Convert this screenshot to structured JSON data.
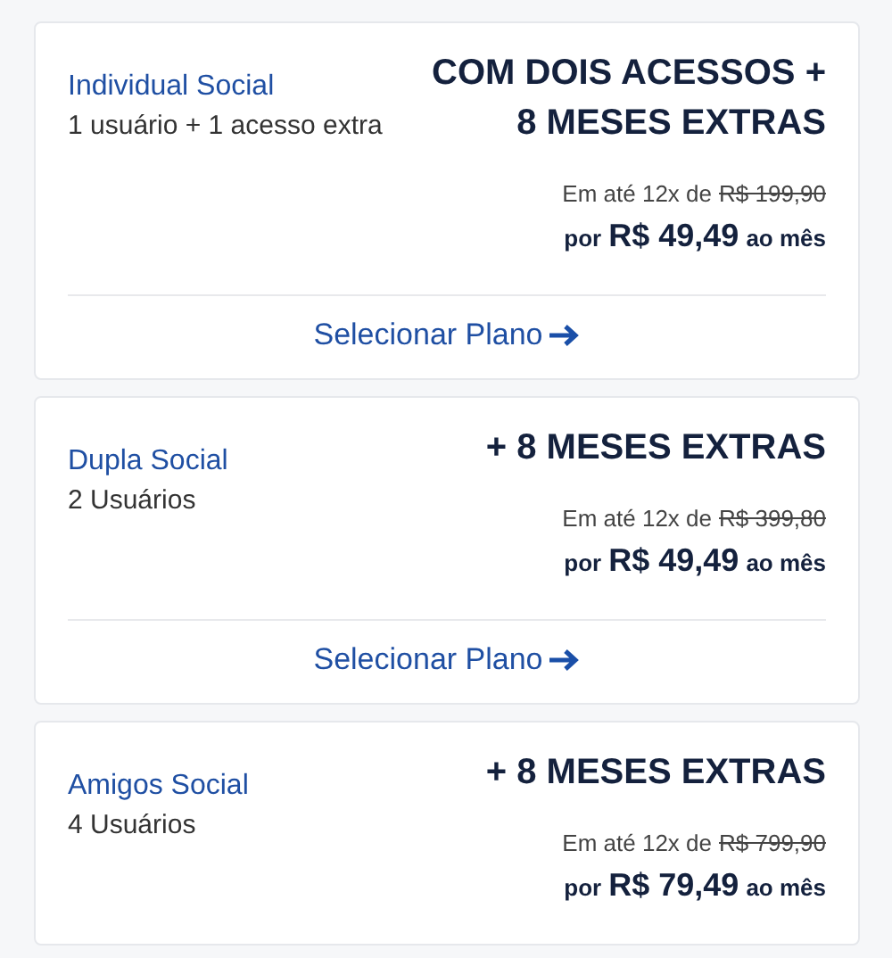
{
  "plans": [
    {
      "name": "Individual Social",
      "users": "1 usuário + 1 acesso extra",
      "headline": "COM DOIS ACESSOS + 8 MESES EXTRAS",
      "installment_prefix": "Em até 12x de",
      "old_price": "R$ 199,90",
      "price_prefix": "por",
      "price": "R$ 49,49",
      "price_suffix": "ao mês",
      "button": "Selecionar Plano"
    },
    {
      "name": "Dupla Social",
      "users": "2 Usuários",
      "headline": "+ 8 MESES EXTRAS",
      "installment_prefix": "Em até 12x de",
      "old_price": "R$ 399,80",
      "price_prefix": "por",
      "price": "R$ 49,49",
      "price_suffix": "ao mês",
      "button": "Selecionar Plano"
    },
    {
      "name": "Amigos Social",
      "users": "4 Usuários",
      "headline": "+ 8 MESES EXTRAS",
      "installment_prefix": "Em até 12x de",
      "old_price": "R$ 799,90",
      "price_prefix": "por",
      "price": "R$ 79,49",
      "price_suffix": "ao mês"
    }
  ]
}
